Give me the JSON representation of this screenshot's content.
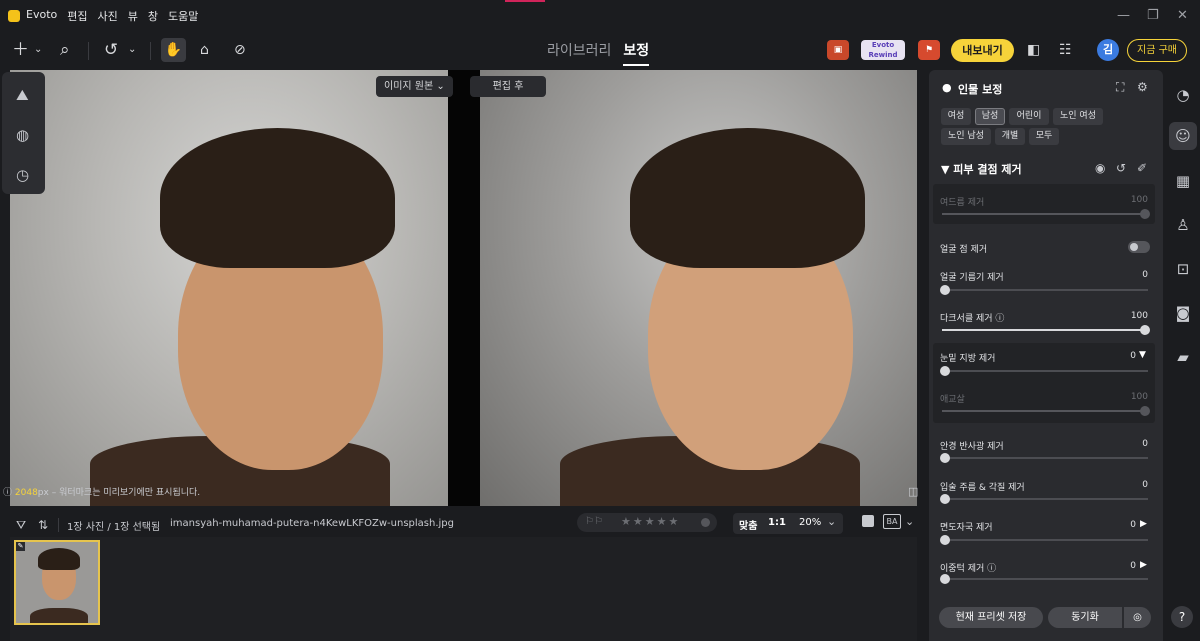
{
  "app": {
    "title": "Evoto",
    "menu": [
      "편집",
      "사진",
      "뷰",
      "창",
      "도움말"
    ]
  },
  "toolbar": {
    "tab_library": "라이브러리",
    "tab_edit": "보정",
    "badge_rewind": "Evoto Rewind",
    "export": "내보내기",
    "avatar": "김",
    "buy": "지금 구매"
  },
  "canvas": {
    "before_button": "이미지 원본",
    "after_button": "편집 후",
    "info_px": "2048",
    "info_unit": "px",
    "info_text": "– 워터마크는 미리보기에만 표시됩니다."
  },
  "bottombar": {
    "count": "1장 사진 / 1장 선택됨",
    "filename": "imansyah-muhamad-putera-n4KewLKFOZw-unsplash.jpg",
    "fit": "맞춤",
    "ratio": "1:1",
    "zoom": "20%"
  },
  "panel": {
    "title": "인물 보정",
    "chips": [
      "여성",
      "남성",
      "어린이",
      "노인 여성",
      "노인 남성",
      "개별",
      "모두"
    ],
    "active_chip": "남성",
    "section": "피부 결점 제거",
    "sliders": [
      {
        "label": "여드름 제거",
        "value": "100",
        "dim": true
      },
      {
        "label": "얼굴 점 제거",
        "value": "",
        "toggle": true
      },
      {
        "label": "얼굴 기름기 제거",
        "value": "0"
      },
      {
        "label": "다크서클 제거",
        "value": "100"
      },
      {
        "label": "눈밑 지방 제거",
        "value": "0"
      },
      {
        "label": "애교살",
        "value": "100",
        "dim": true
      },
      {
        "label": "안경 반사광 제거",
        "value": "0"
      },
      {
        "label": "입술 주름 & 각질 제거",
        "value": "0"
      },
      {
        "label": "면도자국 제거",
        "value": "0"
      },
      {
        "label": "이중턱 제거",
        "value": "0"
      }
    ],
    "save_preset": "현재 프리셋 저장",
    "sync": "동기화"
  },
  "help": "?"
}
